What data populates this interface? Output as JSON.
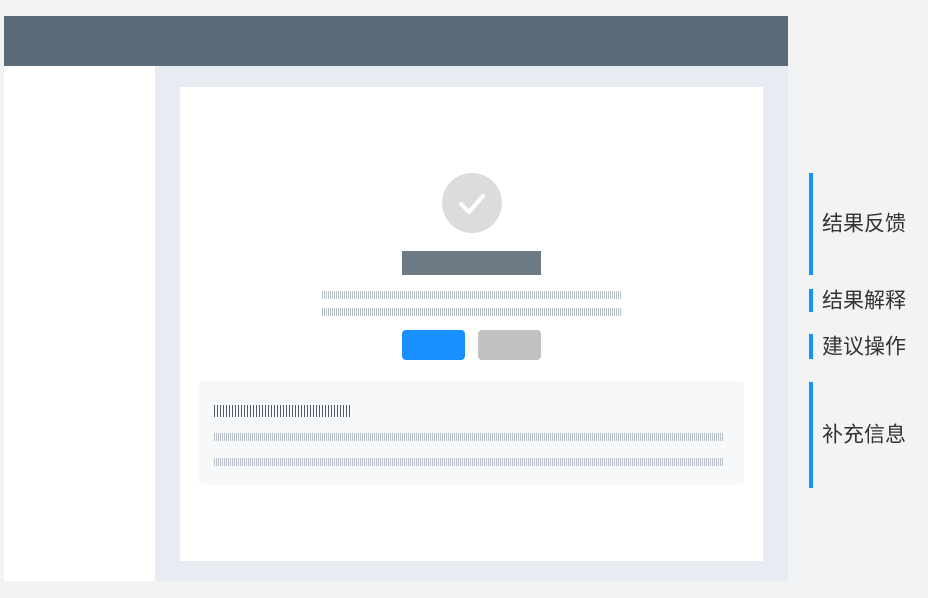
{
  "colors": {
    "background": "#f2f3f5",
    "top_bar": "#5c6b78",
    "content_background": "#e7ebf2",
    "card": "#ffffff",
    "success_icon": "#dcdcdc",
    "title_placeholder": "#6c7a86",
    "primary_button": "#1890ff",
    "secondary_button": "#c1c1c1",
    "extra_panel": "#f7f8f9",
    "annotation_marker": "#1890ff"
  },
  "icons": {
    "success": "check-circle-icon"
  },
  "annotations": {
    "result_feedback": "结果反馈",
    "result_explanation": "结果解释",
    "suggested_actions": "建议操作",
    "extra_info": "补充信息"
  }
}
